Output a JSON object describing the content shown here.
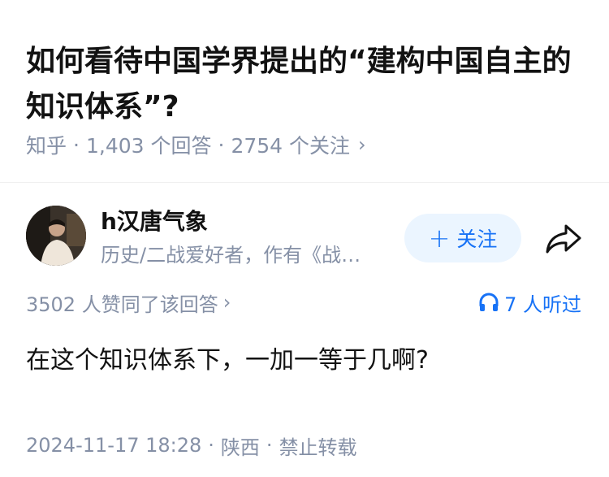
{
  "question": {
    "title": "如何看待中国学界提出的“建构中国自主的知识体系”?",
    "source": "知乎",
    "answers": "1,403 个回答",
    "followers": "2754 个关注"
  },
  "author": {
    "name": "h汉唐气象",
    "bio": "历史/二战爱好者，作有《战…",
    "follow_label": "关注"
  },
  "answer": {
    "votes": "3502 人赞同了该回答",
    "listened": "7 人听过",
    "content": "在这个知识体系下，一加一等于几啊?",
    "date": "2024-11-17 18:28",
    "location": "陕西",
    "copyright": "禁止转载"
  },
  "colors": {
    "accent": "#1772f6",
    "follow_bg": "#ebf5ff",
    "meta": "#8590a6",
    "text": "#121212"
  },
  "icons": {
    "share": "share-icon",
    "headphones": "headphones-icon",
    "chevron": "chevron-right-icon",
    "plus": "plus-icon"
  }
}
